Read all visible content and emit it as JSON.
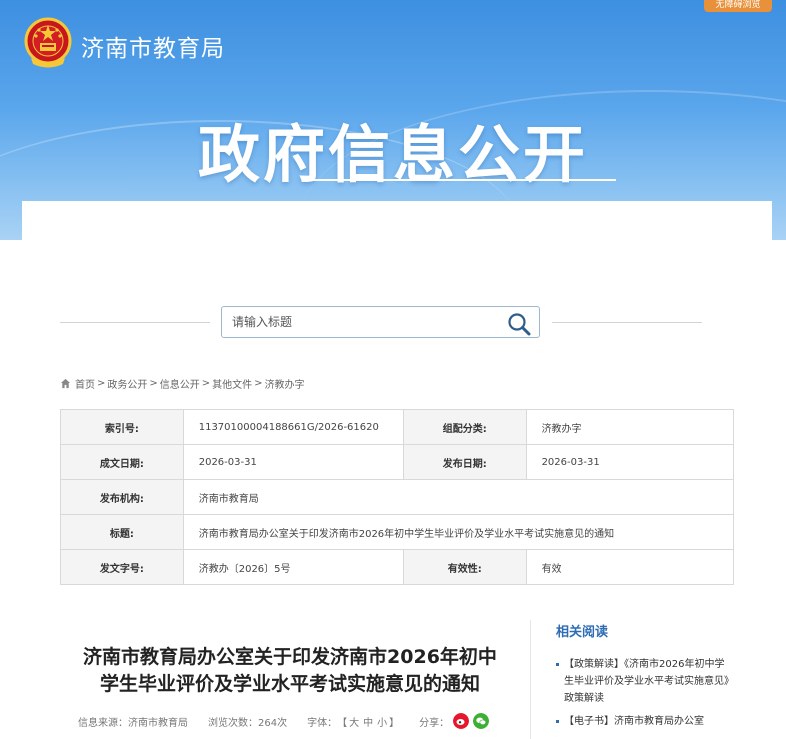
{
  "header": {
    "site_name": "济南市教育局",
    "accessible_label": "无障碍浏览",
    "banner_title": "政府信息公开"
  },
  "search": {
    "placeholder": "请输入标题"
  },
  "breadcrumb": {
    "items": [
      "首页",
      "政务公开",
      "信息公开",
      "其他文件",
      "济教办字"
    ],
    "separator": ">"
  },
  "meta_table": {
    "rows": [
      {
        "k1": "索引号:",
        "v1": "11370100004188661G/2026-61620",
        "k2": "组配分类:",
        "v2": "济教办字"
      },
      {
        "k1": "成文日期:",
        "v1": "2026-03-31",
        "k2": "发布日期:",
        "v2": "2026-03-31"
      },
      {
        "k1": "发布机构:",
        "v1": "济南市教育局"
      },
      {
        "k1": "标题:",
        "v1": "济南市教育局办公室关于印发济南市2026年初中学生毕业评价及学业水平考试实施意见的通知"
      },
      {
        "k1": "发文字号:",
        "v1": "济教办〔2026〕5号",
        "k2": "有效性:",
        "v2": "有效"
      }
    ]
  },
  "article": {
    "title_line1": "济南市教育局办公室关于印发济南市2026年初中",
    "title_line2": "学生毕业评价及学业水平考试实施意见的通知",
    "source_label": "信息来源：",
    "source_value": "济南市教育局",
    "views_label": "浏览次数：",
    "views_value": "264次",
    "font_label": "字体：",
    "font_open": "【",
    "font_large": "大",
    "font_medium": "中",
    "font_small": "小",
    "font_close": "】",
    "share_label": "分享："
  },
  "related": {
    "title": "相关阅读",
    "items": [
      "【政策解读】《济南市2026年初中学生毕业评价及学业水平考试实施意见》政策解读",
      "【电子书】济南市教育局办公室"
    ]
  },
  "colors": {
    "banner_top": "#3d8fe0",
    "accent_blue": "#2e6db4",
    "accessible_orange": "#e8913a",
    "weibo_red": "#e6162d",
    "wechat_green": "#3cb034"
  },
  "icons": [
    "national-emblem-icon",
    "search-icon",
    "home-icon",
    "weibo-icon",
    "wechat-icon"
  ]
}
